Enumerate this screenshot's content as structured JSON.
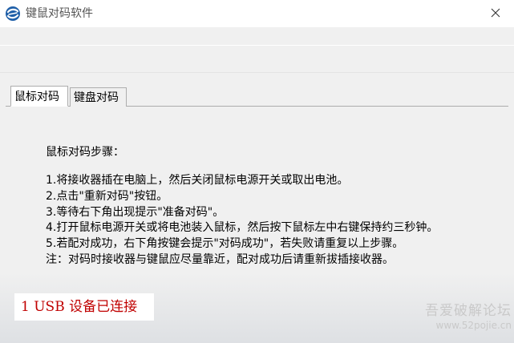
{
  "window": {
    "title": "键鼠对码软件",
    "close_icon": "close-icon"
  },
  "tabs": [
    {
      "label": "鼠标对码",
      "active": true
    },
    {
      "label": "键盘对码",
      "active": false
    }
  ],
  "instructions": {
    "heading": "鼠标对码步骤：",
    "steps": [
      "1.将接收器插在电脑上，然后关闭鼠标电源开关或取出电池。",
      "2.点击\"重新对码\"按钮。",
      "3.等待右下角出现提示\"准备对码\"。",
      "4.打开鼠标电源开关或将电池装入鼠标，然后按下鼠标左中右键保持约三秒钟。",
      "5.若配对成功，右下角按键会提示\"对码成功\"，若失败请重复以上步骤。",
      "注：对码时接收器与键鼠应尽量靠近，配对成功后请重新拔插接收器。"
    ]
  },
  "status": {
    "text": "1 USB 设备已连接",
    "color": "#c00000"
  },
  "watermark": {
    "title": "吾爱破解论坛",
    "url": "www.52pojie.cn"
  },
  "colors": {
    "icon_blue": "#2b6cb0",
    "tab_border": "#adadad",
    "panel_bg": "#f0f0f0"
  }
}
